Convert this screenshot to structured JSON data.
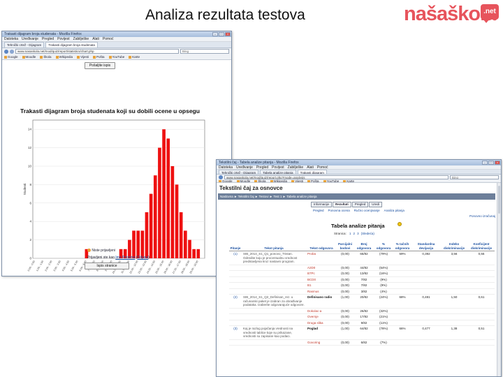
{
  "slide": {
    "title": "Analiza rezultata testova",
    "logo_text": "našaškola",
    "logo_badge": ".net"
  },
  "colors": {
    "bar": "#ee1111",
    "logo": "#e7545c",
    "link": "#1a4fa0"
  },
  "win1": {
    "title": "Trakasti dijagram broja studenata - Mozilla Firefox",
    "menu": [
      "Datoteka",
      "Uređivanje",
      "Pregled",
      "Povijest",
      "Zabilješke",
      "Alati",
      "Pomoć"
    ],
    "tabs": [
      "Tehnički crtež - Dijagram",
      "Trakasti dijagram broja studenata"
    ],
    "url": "www.nasaskola.net/mod/quiz/report/statistics/chart.php",
    "search_placeholder": "Bing",
    "bookmarks": [
      "Google",
      "Moodle",
      "Škola",
      "Wikipedia",
      "Vijesti",
      "Pošta",
      "YouTube",
      "Karte"
    ],
    "print_button": "Pošaljite ispis",
    "chart_title": "Trakasti dijagram broja studenata koji su dobili ocene u opsegu",
    "footer_user_line": "Niste prijavljeni",
    "footer_login_text": "Prijavljeni ste kao",
    "footer_login_user": "Ime Prezime",
    "footer_logout": "Odjava",
    "footer_button": "Ispis stranice"
  },
  "chart_data": {
    "type": "bar",
    "title": "Trakasti dijagram broja studenata koji su dobili ocene u opsegu",
    "xlabel": "Ocena",
    "ylabel": "Studenti",
    "categories": [
      "0.00 - 0.50",
      "0.50 - 1.00",
      "1.00 - 1.50",
      "1.50 - 2.00",
      "2.00 - 2.50",
      "2.50 - 3.00",
      "3.00 - 3.50",
      "3.50 - 4.00",
      "4.00 - 4.50",
      "4.50 - 5.00",
      "5.00 - 5.50",
      "5.50 - 6.00",
      "6.00 - 6.50",
      "6.50 - 7.00",
      "7.00 - 7.50",
      "7.50 - 8.00",
      "8.00 - 8.50",
      "8.50 - 9.00",
      "9.00 - 9.50",
      "9.50 - 10.00",
      "10.00 - 10.50",
      "10.50 - 11.00",
      "11.00 - 11.50",
      "11.50 - 12.00",
      "12.00 - 12.50",
      "12.50 - 13.00",
      "13.00 - 13.50",
      "13.50 - 14.00",
      "14.00 - 14.50",
      "14.50 - 15.00",
      "15.00 - 15.50",
      "15.50 - 16.00",
      "16.00 - 16.50",
      "16.50 - 17.00",
      "17.00 - 17.50",
      "17.50 - 18.00",
      "18.00 - 18.50",
      "18.50 - 19.00",
      "19.00 - 19.50",
      "19.50 - 20.00"
    ],
    "values": [
      0,
      0,
      0,
      0,
      0,
      0,
      0,
      0,
      0,
      0,
      0,
      0,
      1,
      0,
      0,
      0,
      0,
      0,
      0,
      0,
      1,
      1,
      2,
      3,
      3,
      3,
      5,
      7,
      9,
      12,
      14,
      13,
      10,
      8,
      5,
      3,
      2,
      1,
      1,
      0
    ],
    "yticks": [
      0,
      2,
      4,
      6,
      8,
      10,
      12,
      14
    ],
    "ylim": [
      0,
      15
    ],
    "grid": true
  },
  "win2": {
    "title": "Tekstilni čaj - Tabela analize pitanja - Mozilla Firefox",
    "menu": [
      "Datoteka",
      "Uređivanje",
      "Pregled",
      "Povijest",
      "Zabilješke",
      "Alati",
      "Pomoć"
    ],
    "tabs": [
      "Tehnički crtež - Dijagram",
      "Tabela analize pitanja",
      "Trakasti dijagram"
    ],
    "url": "www.nasaskola.net/mod/quiz/report.php?mode=analysis",
    "search_placeholder": "Bing",
    "bookmarks": [
      "Google",
      "Moodle",
      "Škola",
      "Wikipedia",
      "Vijesti",
      "Pošta",
      "YouTube",
      "Karte"
    ],
    "site_title": "Tekstilni čaj za osnovce",
    "breadcrumb": "Naslovna  ►  Tekstilni čaj  ►  Testovi  ►  Test 1  ►  Tabela analize pitanja",
    "quiz_tabs": [
      "Informacije",
      "Rezultati",
      "Pregled",
      "Uredi"
    ],
    "subnav": [
      "Pregled",
      "Ponovna ocena",
      "Ručno ocenjivanje",
      "Analiza pitanja"
    ],
    "topright_link": "Ponovno izračunaj",
    "table_title": "Tabela analize pitanja",
    "pager_label": "Stranica:",
    "pager_pages": [
      "1",
      "2",
      "3",
      "(Sledeća)"
    ],
    "headers": [
      "Pitanje",
      "Tekst pitanja",
      "Tekst odgovora",
      "Parcijalni bodovi",
      "Broj odgovora",
      "% odgovora",
      "% tačnih odgovora",
      "Standardna devijacija",
      "Indeks diskriminacije",
      "Koeficijent diskriminacije"
    ],
    "rows": [
      {
        "qid": "(1)",
        "q": "SIB_2014_S1_Q1_ponovo_Tristan. Odredite koju je procentualnu vrednost predstavljena kroz nastavni program.",
        "ans": "Proba",
        "correct": false,
        "partial": "(0,00)",
        "count": "65/82",
        "pct": "(79%)",
        "ptc": "59%",
        "sd": "0,392",
        "di": "3,56",
        "dc": "0,55",
        "group": true
      },
      {
        "qid": "",
        "q": "",
        "ans": "A2D0",
        "correct": false,
        "partial": "(0,00)",
        "count": "44/82",
        "pct": "(54%)",
        "ptc": "",
        "sd": "",
        "di": "",
        "dc": "",
        "group": false
      },
      {
        "qid": "",
        "q": "",
        "ans": "B7Pc",
        "correct": false,
        "partial": "(0,00)",
        "count": "13/82",
        "pct": "(16%)",
        "ptc": "",
        "sd": "",
        "di": "",
        "dc": "",
        "group": false
      },
      {
        "qid": "",
        "q": "",
        "ans": "BCD0",
        "correct": false,
        "partial": "(0,00)",
        "count": "7/82",
        "pct": "(9%)",
        "ptc": "",
        "sd": "",
        "di": "",
        "dc": "",
        "group": false
      },
      {
        "qid": "",
        "q": "",
        "ans": "B1",
        "correct": false,
        "partial": "(0,00)",
        "count": "7/82",
        "pct": "(9%)",
        "ptc": "",
        "sd": "",
        "di": "",
        "dc": "",
        "group": false
      },
      {
        "qid": "",
        "q": "",
        "ans": "Rasmus",
        "correct": false,
        "partial": "(0,00)",
        "count": "3/82",
        "pct": "(4%)",
        "ptc": "",
        "sd": "",
        "di": "",
        "dc": "",
        "group": false
      },
      {
        "qid": "(2)",
        "q": "SIB_2014_S1_Q2_Definisan_rez. u računarski paket je izabran za obrađivanje podataka. Izaberite odgovarajuće odgovore.",
        "ans": "Definisano radio",
        "correct": true,
        "partial": "(1,00)",
        "count": "20/82",
        "pct": "(24%)",
        "ptc": "68%",
        "sd": "0,481",
        "di": "1,50",
        "dc": "0,61",
        "group": true
      },
      {
        "qid": "",
        "q": "",
        "ans": "Dokolac-a",
        "correct": false,
        "partial": "(0,00)",
        "count": "26/82",
        "pct": "(32%)",
        "ptc": "",
        "sd": "",
        "di": "",
        "dc": "",
        "group": false
      },
      {
        "qid": "",
        "q": "",
        "ans": "Overnje",
        "correct": false,
        "partial": "(0,00)",
        "count": "17/82",
        "pct": "(21%)",
        "ptc": "",
        "sd": "",
        "di": "",
        "dc": "",
        "group": false
      },
      {
        "qid": "",
        "q": "",
        "ans": "Druga slika",
        "correct": false,
        "partial": "(0,00)",
        "count": "9/82",
        "pct": "(11%)",
        "ptc": "",
        "sd": "",
        "di": "",
        "dc": "",
        "group": false
      },
      {
        "qid": "(3)",
        "q": "Kaj je razlog pojačanja vrednosti na vrednosti tablice koje su prikazane, vrednosti su zapisane kao podaci.",
        "ans": "Poglad",
        "correct": true,
        "partial": "(1,00)",
        "count": "64/82",
        "pct": "(78%)",
        "ptc": "66%",
        "sd": "0,477",
        "di": "1,38",
        "dc": "0,51",
        "group": true
      },
      {
        "qid": "",
        "q": "",
        "ans": "Govoring",
        "correct": false,
        "partial": "(0,00)",
        "count": "6/82",
        "pct": "(7%)",
        "ptc": "",
        "sd": "",
        "di": "",
        "dc": "",
        "group": false
      }
    ]
  }
}
